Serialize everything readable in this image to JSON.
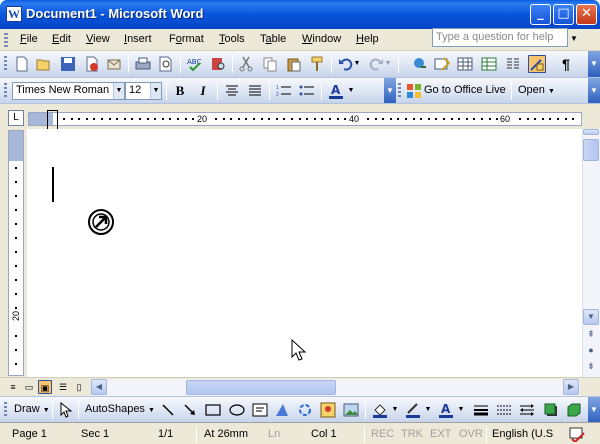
{
  "window": {
    "title": "Document1 - Microsoft Word",
    "app_icon_letter": "W",
    "minimize_glyph": "_",
    "maximize_glyph": "□",
    "close_glyph": "✕"
  },
  "menu": {
    "items": [
      {
        "label": "File",
        "accel": "F"
      },
      {
        "label": "Edit",
        "accel": "E"
      },
      {
        "label": "View",
        "accel": "V"
      },
      {
        "label": "Insert",
        "accel": "I"
      },
      {
        "label": "Format",
        "accel": "o"
      },
      {
        "label": "Tools",
        "accel": "T"
      },
      {
        "label": "Table",
        "accel": "a"
      },
      {
        "label": "Window",
        "accel": "W"
      },
      {
        "label": "Help",
        "accel": "H"
      }
    ],
    "help_placeholder": "Type a question for help"
  },
  "standard_toolbar": {
    "icons": [
      "new-document-icon",
      "open-icon",
      "save-icon",
      "permission-icon",
      "email-icon",
      "print-icon",
      "print-preview-icon",
      "spelling-icon",
      "research-icon",
      "cut-icon",
      "copy-icon",
      "paste-icon",
      "format-painter-icon",
      "undo-icon",
      "redo-icon",
      "hyperlink-icon",
      "tables-borders-icon",
      "insert-table-icon",
      "insert-excel-icon",
      "columns-icon",
      "drawing-icon",
      "show-hide-icon"
    ],
    "pilcrow": "¶"
  },
  "formatting_toolbar": {
    "font_name": "Times New Roman",
    "font_size": "12",
    "bold": "B",
    "italic": "I",
    "office_live_label": "Go to Office Live",
    "open_label": "Open"
  },
  "ruler": {
    "tab_selector": "L",
    "labels": [
      "20",
      "40",
      "60"
    ],
    "vertical_label": "20"
  },
  "drawing_toolbar": {
    "draw_label": "Draw",
    "autoshapes_label": "AutoShapes"
  },
  "status": {
    "page": "Page 1",
    "sec": "Sec 1",
    "count": "1/1",
    "at": "At 26mm",
    "ln": "Ln",
    "col": "Col 1",
    "rec": "REC",
    "trk": "TRK",
    "ext": "EXT",
    "ovr": "OVR",
    "language": "English (U.S"
  }
}
